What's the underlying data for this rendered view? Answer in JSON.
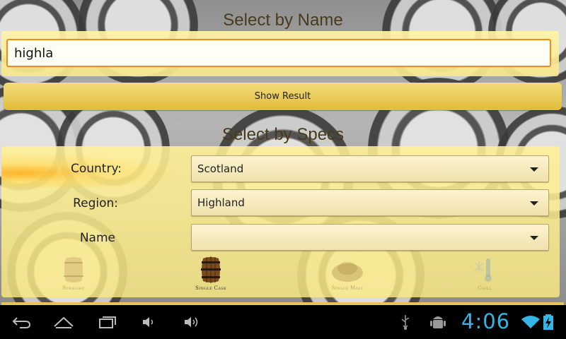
{
  "name_section": {
    "title": "Select by Name",
    "input_value": "highla",
    "show_button": "Show Result"
  },
  "specs_section": {
    "title": "Select by Specs",
    "fields": [
      {
        "label": "Country:",
        "value": "Scotland"
      },
      {
        "label": "Region:",
        "value": "Highland"
      },
      {
        "label": "Name",
        "value": ""
      }
    ],
    "categories": [
      {
        "label": "Straight",
        "icon": "barrel-icon",
        "active": false
      },
      {
        "label": "Single Cask",
        "icon": "barrel-icon",
        "active": true
      },
      {
        "label": "Single Malt",
        "icon": "grain-icon",
        "active": false
      },
      {
        "label": "Chill",
        "icon": "thermometer-icon",
        "active": false
      }
    ]
  },
  "system_bar": {
    "time": "4:06",
    "icons": [
      "back-icon",
      "home-icon",
      "recent-apps-icon",
      "volume-down-icon",
      "volume-up-icon",
      "usb-icon",
      "android-debug-icon",
      "wifi-icon",
      "battery-charging-icon"
    ],
    "accent": "#33b5e5"
  },
  "colors": {
    "panel": "#f8e88c",
    "button": "#e1bc3a",
    "input_border": "#f08c1a",
    "title_text": "#4a3a1c"
  }
}
